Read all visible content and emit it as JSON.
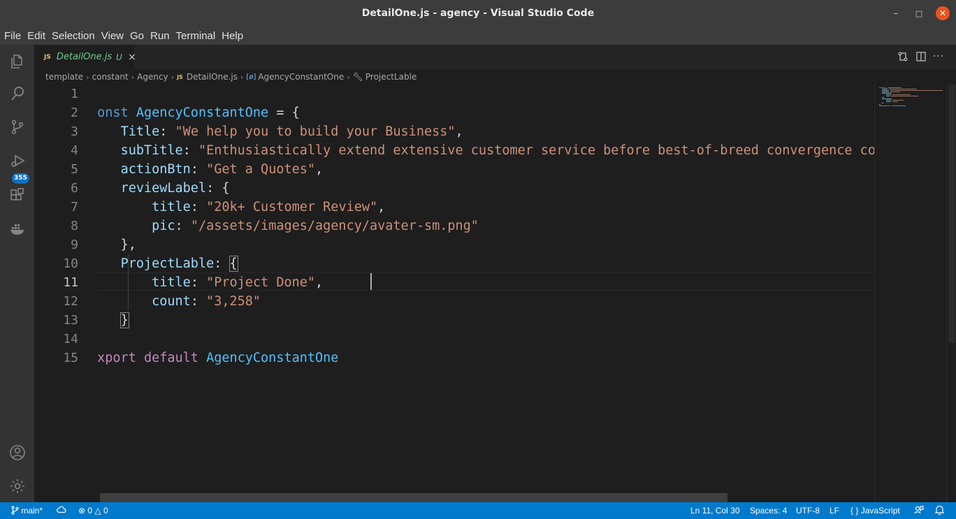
{
  "window": {
    "title": "DetailOne.js - agency - Visual Studio Code",
    "min_icon": "minimize-icon",
    "max_icon": "maximize-icon",
    "close_icon": "close-icon"
  },
  "menu": [
    "File",
    "Edit",
    "Selection",
    "View",
    "Go",
    "Run",
    "Terminal",
    "Help"
  ],
  "activity_bar": {
    "items": [
      "explorer-icon",
      "search-icon",
      "source-control-icon",
      "run-debug-icon",
      "extensions-icon",
      "docker-icon"
    ],
    "scm_badge": "355",
    "bottom": [
      "accounts-icon",
      "manage-gear-icon"
    ]
  },
  "tab": {
    "icon": "JS",
    "label": "DetailOne.js",
    "status": "U",
    "close": "×"
  },
  "editor_actions": [
    "compare-changes-icon",
    "split-editor-icon",
    "more-actions-icon"
  ],
  "breadcrumb": {
    "parts": [
      "template",
      "constant",
      "Agency"
    ],
    "file_icon": "JS",
    "file": "DetailOne.js",
    "symbol_icon": "[ø]",
    "symbol": "AgencyConstantOne",
    "property": "ProjectLable"
  },
  "editor": {
    "line_numbers": [
      "1",
      "2",
      "3",
      "4",
      "5",
      "6",
      "7",
      "8",
      "9",
      "10",
      "11",
      "12",
      "13",
      "14",
      "15"
    ],
    "active_line": 11,
    "lines": [
      [],
      [
        [
          "kw",
          "const"
        ],
        [
          "punc",
          " "
        ],
        [
          "const",
          "AgencyConstantOne"
        ],
        [
          "punc",
          " = {"
        ]
      ],
      [
        [
          "punc",
          "    "
        ],
        [
          "prop",
          "Title"
        ],
        [
          "punc",
          ": "
        ],
        [
          "str",
          "\"We help you to build your Business\""
        ],
        [
          "punc",
          ","
        ]
      ],
      [
        [
          "punc",
          "    "
        ],
        [
          "prop",
          "subTitle"
        ],
        [
          "punc",
          ": "
        ],
        [
          "str",
          "\"Enthusiastically extend extensive customer service before best-of-breed convergence completely.\""
        ],
        [
          "punc",
          ","
        ]
      ],
      [
        [
          "punc",
          "    "
        ],
        [
          "prop",
          "actionBtn"
        ],
        [
          "punc",
          ": "
        ],
        [
          "str",
          "\"Get a Quotes\""
        ],
        [
          "punc",
          ","
        ]
      ],
      [
        [
          "punc",
          "    "
        ],
        [
          "prop",
          "reviewLabel"
        ],
        [
          "punc",
          ": {"
        ]
      ],
      [
        [
          "punc",
          "        "
        ],
        [
          "prop",
          "title"
        ],
        [
          "punc",
          ": "
        ],
        [
          "str",
          "\"20k+ Customer Review\""
        ],
        [
          "punc",
          ","
        ]
      ],
      [
        [
          "punc",
          "        "
        ],
        [
          "prop",
          "pic"
        ],
        [
          "punc",
          ": "
        ],
        [
          "str",
          "\"/assets/images/agency/avater-sm.png\""
        ]
      ],
      [
        [
          "punc",
          "    },"
        ]
      ],
      [
        [
          "punc",
          "    "
        ],
        [
          "prop",
          "ProjectLable"
        ],
        [
          "punc",
          ": "
        ],
        [
          "hl",
          "{"
        ]
      ],
      [
        [
          "punc",
          "        "
        ],
        [
          "prop",
          "title"
        ],
        [
          "punc",
          ": "
        ],
        [
          "str",
          "\"Project Done\""
        ],
        [
          "punc",
          ","
        ]
      ],
      [
        [
          "punc",
          "        "
        ],
        [
          "prop",
          "count"
        ],
        [
          "punc",
          ": "
        ],
        [
          "str",
          "\"3,258\""
        ]
      ],
      [
        [
          "punc",
          "    "
        ],
        [
          "hl",
          "}"
        ]
      ],
      [
        [
          "punc",
          "}"
        ]
      ],
      [
        [
          "kw2",
          "export"
        ],
        [
          "punc",
          " "
        ],
        [
          "kw2",
          "default"
        ],
        [
          "punc",
          " "
        ],
        [
          "const",
          "AgencyConstantOne"
        ]
      ]
    ]
  },
  "status_bar": {
    "branch": "main*",
    "sync_icon": "sync-icon",
    "errors": "0",
    "warnings": "0",
    "position": "Ln 11, Col 30",
    "spaces": "Spaces: 4",
    "encoding": "UTF-8",
    "eol": "LF",
    "language_icon": "{ }",
    "language": "JavaScript",
    "feedback_icon": "feedback-icon",
    "bell_icon": "bell-icon"
  }
}
